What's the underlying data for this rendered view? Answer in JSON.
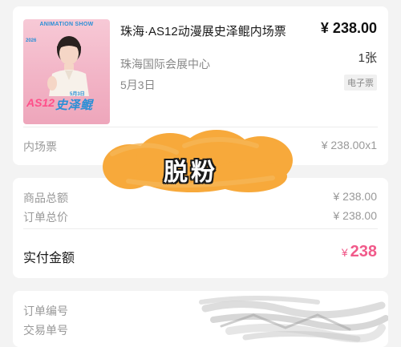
{
  "order_item": {
    "poster": {
      "top_text": "ANIMATION SHOW",
      "side_text": "2026",
      "as_text": "AS12",
      "date_text": "5月3日",
      "name_text": "史泽鲲"
    },
    "title": "珠海·AS12动漫展史泽鲲内场票",
    "price": "¥ 238.00",
    "venue": "珠海国际会展中心",
    "quantity": "1张",
    "date": "5月3日",
    "ticket_type": "电子票",
    "sub_label": "内场票",
    "sub_value": "¥ 238.00x1"
  },
  "sticker": {
    "text": "脱粉",
    "color": "#f7a93b"
  },
  "totals": {
    "goods_total_label": "商品总额",
    "goods_total_value": "¥ 238.00",
    "order_total_label": "订单总价",
    "order_total_value": "¥ 238.00",
    "paid_label": "实付金额",
    "paid_currency": "¥",
    "paid_amount": "238",
    "paid_color": "#f15a8a"
  },
  "ids": {
    "order_no_label": "订单编号",
    "trade_no_label": "交易单号"
  }
}
